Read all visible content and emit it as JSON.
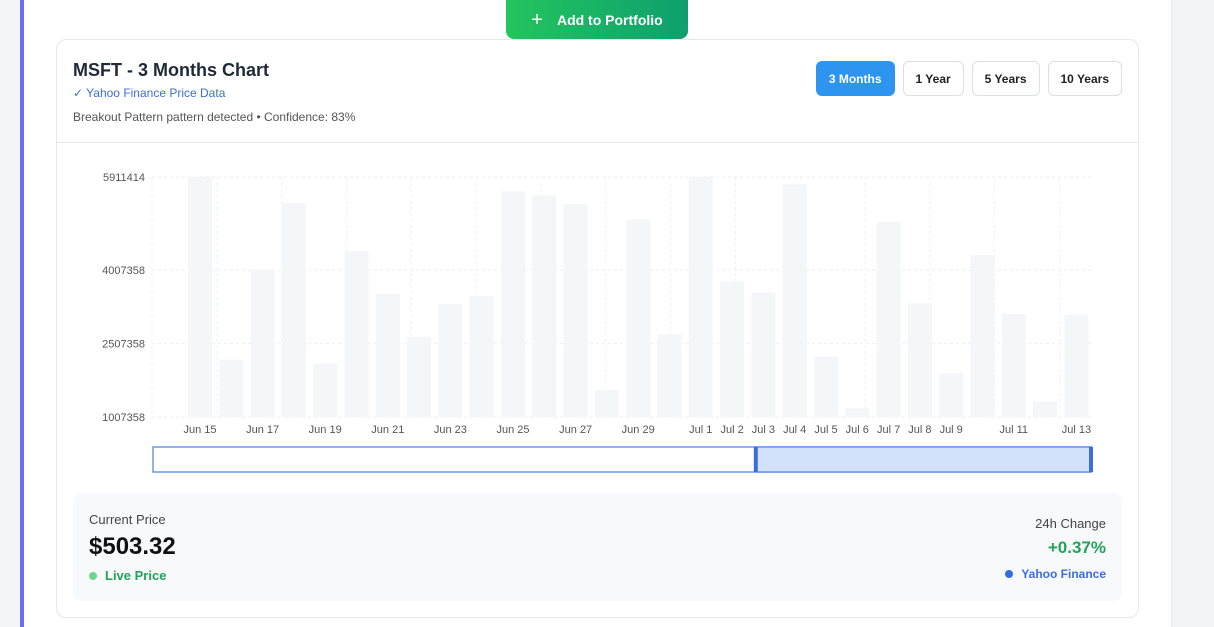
{
  "actions": {
    "add_label": "Add to Portfolio",
    "add_icon": "plus-icon"
  },
  "header": {
    "title": "MSFT - 3 Months Chart",
    "source": "✓ Yahoo Finance Price Data",
    "pattern": "Breakout Pattern pattern detected • Confidence: 83%",
    "ranges": [
      "3 Months",
      "1 Year",
      "5 Years",
      "10 Years"
    ],
    "active_range": "3 Months"
  },
  "colors": {
    "accent": "#2d95f0",
    "positive": "#22a35a",
    "link": "#3b6fd4",
    "panel_border": "#6b6cf0",
    "bar_fill": "#f5f6f8",
    "brush_fill": "#d3e1fb",
    "brush_stroke": "#6f98e6"
  },
  "chart_data": {
    "type": "bar",
    "y_ticks": [
      "5911414",
      "4007358",
      "2507358",
      "1007358"
    ],
    "ylim": [
      1007358,
      5911414
    ],
    "x_tick_labels": [
      "Jun 15",
      "Jun 17",
      "Jun 19",
      "Jun 21",
      "Jun 23",
      "Jun 25",
      "Jun 27",
      "Jun 29",
      "Jul 1",
      "Jul 2",
      "Jul 3",
      "Jul 4",
      "Jul 5",
      "Jul 6",
      "Jul 7",
      "Jul 8",
      "Jul 9",
      "Jul 11",
      "Jul 13"
    ],
    "values": [
      5911414,
      2180000,
      4007358,
      5380000,
      2100000,
      4400000,
      3520000,
      2640000,
      3320000,
      3480000,
      5620000,
      5540000,
      5360000,
      1560000,
      5040000,
      2700000,
      5911414,
      3780000,
      3550000,
      5760000,
      2240000,
      1180000,
      4990000,
      3330000,
      1900000,
      4320000,
      3110000,
      1320000,
      3100000
    ],
    "brush_range": [
      0.6,
      1.0
    ],
    "grid": true,
    "legend": "none"
  },
  "stats": {
    "current_price_label": "Current Price",
    "current_price": "$503.32",
    "live_label": "Live Price",
    "change_label": "24h Change",
    "change_value": "+0.37%",
    "provider": "Yahoo Finance"
  }
}
